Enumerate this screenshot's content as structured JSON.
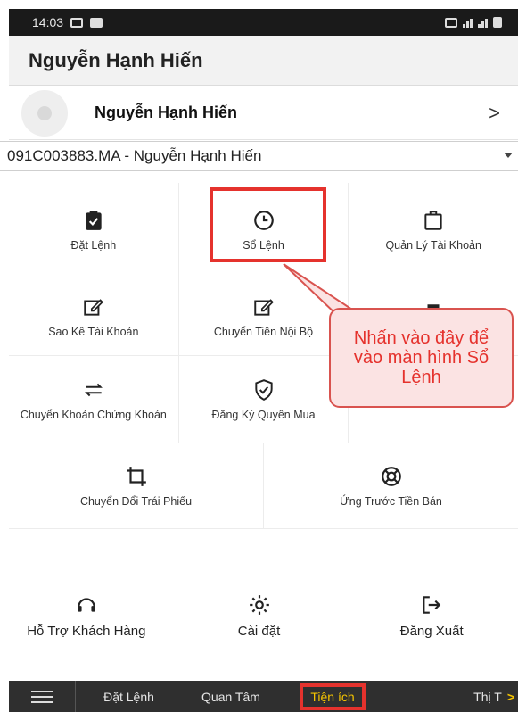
{
  "status_bar": {
    "time": "14:03"
  },
  "app_bar": {
    "title": "Nguyễn Hạnh Hiến"
  },
  "profile": {
    "name": "Nguyễn Hạnh Hiến",
    "chevron": ">"
  },
  "account_select": {
    "value": "091C003883.MA - Nguyễn Hạnh Hiến"
  },
  "menu": {
    "dat_lenh": "Đặt Lệnh",
    "so_lenh": "Sổ Lệnh",
    "quan_ly_tai_khoan": "Quản Lý Tài Khoản",
    "sao_ke_tai_khoan": "Sao Kê Tài Khoản",
    "chuyen_tien_noi_bo": "Chuyển Tiền Nội Bộ",
    "chuyen_khoan_chung_khoan": "Chuyển Khoản Chứng Khoán",
    "dang_ky_quyen_mua": "Đăng Ký Quyền Mua",
    "chuyen_doi_trai_phieu": "Chuyển Đổi Trái Phiếu",
    "ung_truoc_tien_ban": "Ứng Trước Tiền Bán"
  },
  "callout": {
    "text": "Nhấn vào đây để vào màn hình Sổ Lệnh"
  },
  "actions": {
    "support": "Hỗ Trợ Khách Hàng",
    "settings": "Cài đặt",
    "logout": "Đăng Xuất"
  },
  "bottom_nav": {
    "tab1": "Đặt Lệnh",
    "tab2": "Quan Tâm",
    "tab3": "Tiện ích",
    "tab4": "Thị T",
    "arrow": ">"
  }
}
